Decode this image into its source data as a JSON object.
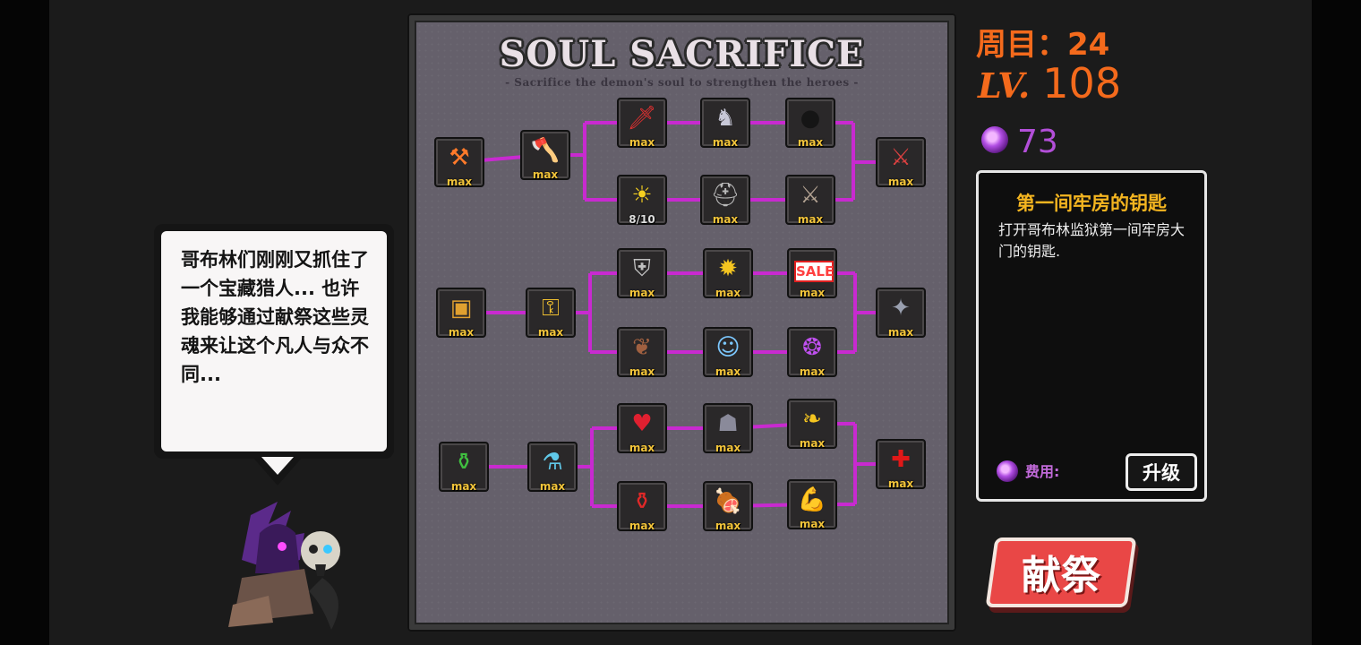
{
  "board": {
    "title": "SOUL SACRIFICE",
    "subtitle": "- Sacrifice the demon's soul to strengthen the heroes -"
  },
  "status": {
    "round_label": "周目：24",
    "level_tag": "LV.",
    "level_value": "108",
    "souls": "73"
  },
  "info_panel": {
    "title": "第一间牢房的钥匙",
    "description": "打开哥布林监狱第一间牢房大门的钥匙.",
    "cost_label": "费用:",
    "upgrade_label": "升级"
  },
  "sacrifice_button": "献祭",
  "dialogue": "哥布林们刚刚又抓住了一个宝藏猎人... 也许我能够通过献祭这些灵魂来让这个凡人与众不同...",
  "icon_names": [
    "anvil-fire",
    "axe",
    "sword-up",
    "armored-knight",
    "bomb",
    "crossed-axes",
    "sun-up",
    "helmet",
    "claw-blades",
    "treasure-chest",
    "key",
    "shield-up",
    "treasure-explosion",
    "sale-sign",
    "compass",
    "winged-boot",
    "ghost-halo",
    "purple-soul",
    "cauldron",
    "potion-bottle",
    "heart-up",
    "hooded-reaper",
    "golden-drop",
    "red-cross",
    "red-potion",
    "meat",
    "muscle-arm"
  ],
  "skills": [
    {
      "id": "anvil-fire",
      "glyph": "⚒",
      "color": "#ff7a2a",
      "label": "max"
    },
    {
      "id": "axe",
      "glyph": "🪓",
      "color": "#d8d8d8",
      "label": "max"
    },
    {
      "id": "sword-up",
      "glyph": "🗡",
      "color": "#e23030",
      "label": "max"
    },
    {
      "id": "armored-knight",
      "glyph": "♞",
      "color": "#c8c8d8",
      "label": "max"
    },
    {
      "id": "bomb",
      "glyph": "●",
      "color": "#151515",
      "label": "max"
    },
    {
      "id": "crossed-axes",
      "glyph": "⚔",
      "color": "#d94040",
      "label": "max"
    },
    {
      "id": "sun-up",
      "glyph": "☀",
      "color": "#f5d020",
      "label": "8/10"
    },
    {
      "id": "helmet",
      "glyph": "⛑",
      "color": "#b8b8b8",
      "label": "max"
    },
    {
      "id": "claw-blades",
      "glyph": "⚔",
      "color": "#b0a090",
      "label": "max"
    },
    {
      "id": "treasure-chest",
      "glyph": "▣",
      "color": "#e0a030",
      "label": "max"
    },
    {
      "id": "key",
      "glyph": "⚿",
      "color": "#f0c030",
      "label": "max"
    },
    {
      "id": "shield-up",
      "glyph": "⛨",
      "color": "#c0c0c0",
      "label": "max"
    },
    {
      "id": "treasure-explosion",
      "glyph": "✹",
      "color": "#f5c520",
      "label": "max"
    },
    {
      "id": "sale-sign",
      "glyph": "SALE",
      "color": "#ff4040",
      "label": "max"
    },
    {
      "id": "compass",
      "glyph": "✦",
      "color": "#9aa0b0",
      "label": "max"
    },
    {
      "id": "winged-boot",
      "glyph": "❦",
      "color": "#a06040",
      "label": "max"
    },
    {
      "id": "ghost-halo",
      "glyph": "☺",
      "color": "#7cc8ff",
      "label": "max"
    },
    {
      "id": "purple-soul",
      "glyph": "❂",
      "color": "#c050f0",
      "label": "max"
    },
    {
      "id": "cauldron",
      "glyph": "⚱",
      "color": "#40c040",
      "label": "max"
    },
    {
      "id": "potion-bottle",
      "glyph": "⚗",
      "color": "#60c8e8",
      "label": "max"
    },
    {
      "id": "heart-up",
      "glyph": "♥",
      "color": "#e02030",
      "label": "max"
    },
    {
      "id": "hooded-reaper",
      "glyph": "☗",
      "color": "#8a8a9a",
      "label": "max"
    },
    {
      "id": "golden-drop",
      "glyph": "❧",
      "color": "#f5c520",
      "label": "max"
    },
    {
      "id": "red-cross",
      "glyph": "✚",
      "color": "#e01818",
      "label": "max"
    },
    {
      "id": "red-potion",
      "glyph": "⚱",
      "color": "#e02828",
      "label": "max"
    },
    {
      "id": "meat",
      "glyph": "🍖",
      "color": "#b06040",
      "label": "max"
    },
    {
      "id": "muscle-arm",
      "glyph": "💪",
      "color": "#e8c8a8",
      "label": "max"
    }
  ],
  "colors": {
    "accent_orange": "#f46a1c",
    "soul_purple": "#b34fd9",
    "skill_label": "#f2c43a",
    "link_line": "#c82ad0",
    "sacrifice_red": "#e94746"
  }
}
